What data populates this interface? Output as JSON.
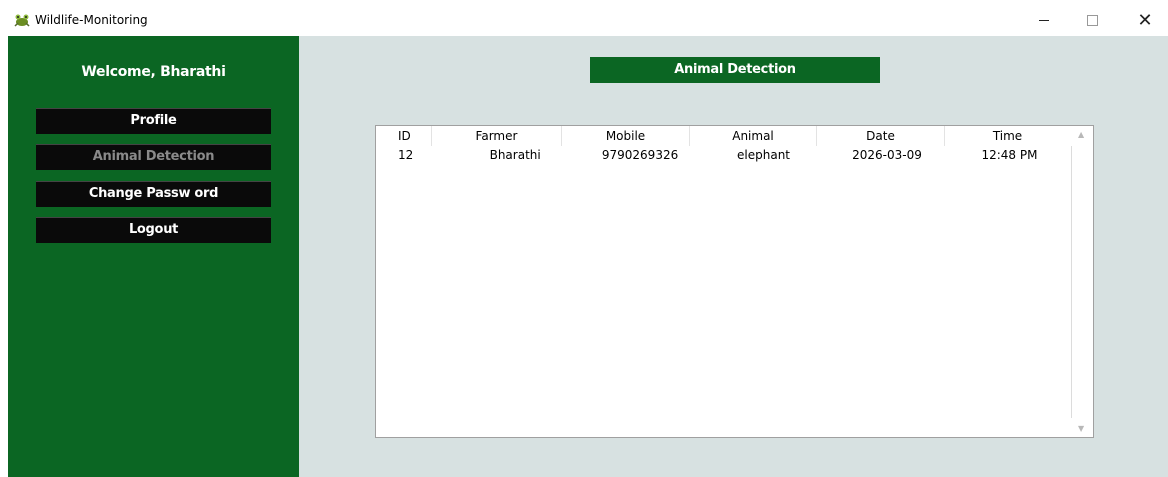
{
  "window": {
    "title": "Wildlife-Monitoring",
    "controls": {
      "minimize": "—",
      "close": "✕"
    }
  },
  "sidebar": {
    "welcome": "Welcome, Bharathi",
    "items": [
      {
        "label": "Profile",
        "enabled": true
      },
      {
        "label": "Animal Detection",
        "enabled": false
      },
      {
        "label": "Change Passw ord",
        "enabled": true
      },
      {
        "label": "Logout",
        "enabled": true
      }
    ]
  },
  "main": {
    "header": "Animal Detection",
    "table": {
      "columns": [
        "ID",
        "Farmer",
        "Mobile",
        "Animal",
        "Date",
        "Time"
      ],
      "rows": [
        [
          "12",
          "Bharathi",
          "9790269326",
          "elephant",
          "2026-03-09",
          "12:48 PM"
        ]
      ]
    }
  },
  "colors": {
    "sidebar_green": "#0b6623",
    "main_bg": "#d7e1e1",
    "button_black": "#0a0a0a"
  },
  "icons": {
    "app": "frog-app-icon",
    "scroll_up": "chevron-up-icon",
    "scroll_down": "chevron-down-icon"
  }
}
